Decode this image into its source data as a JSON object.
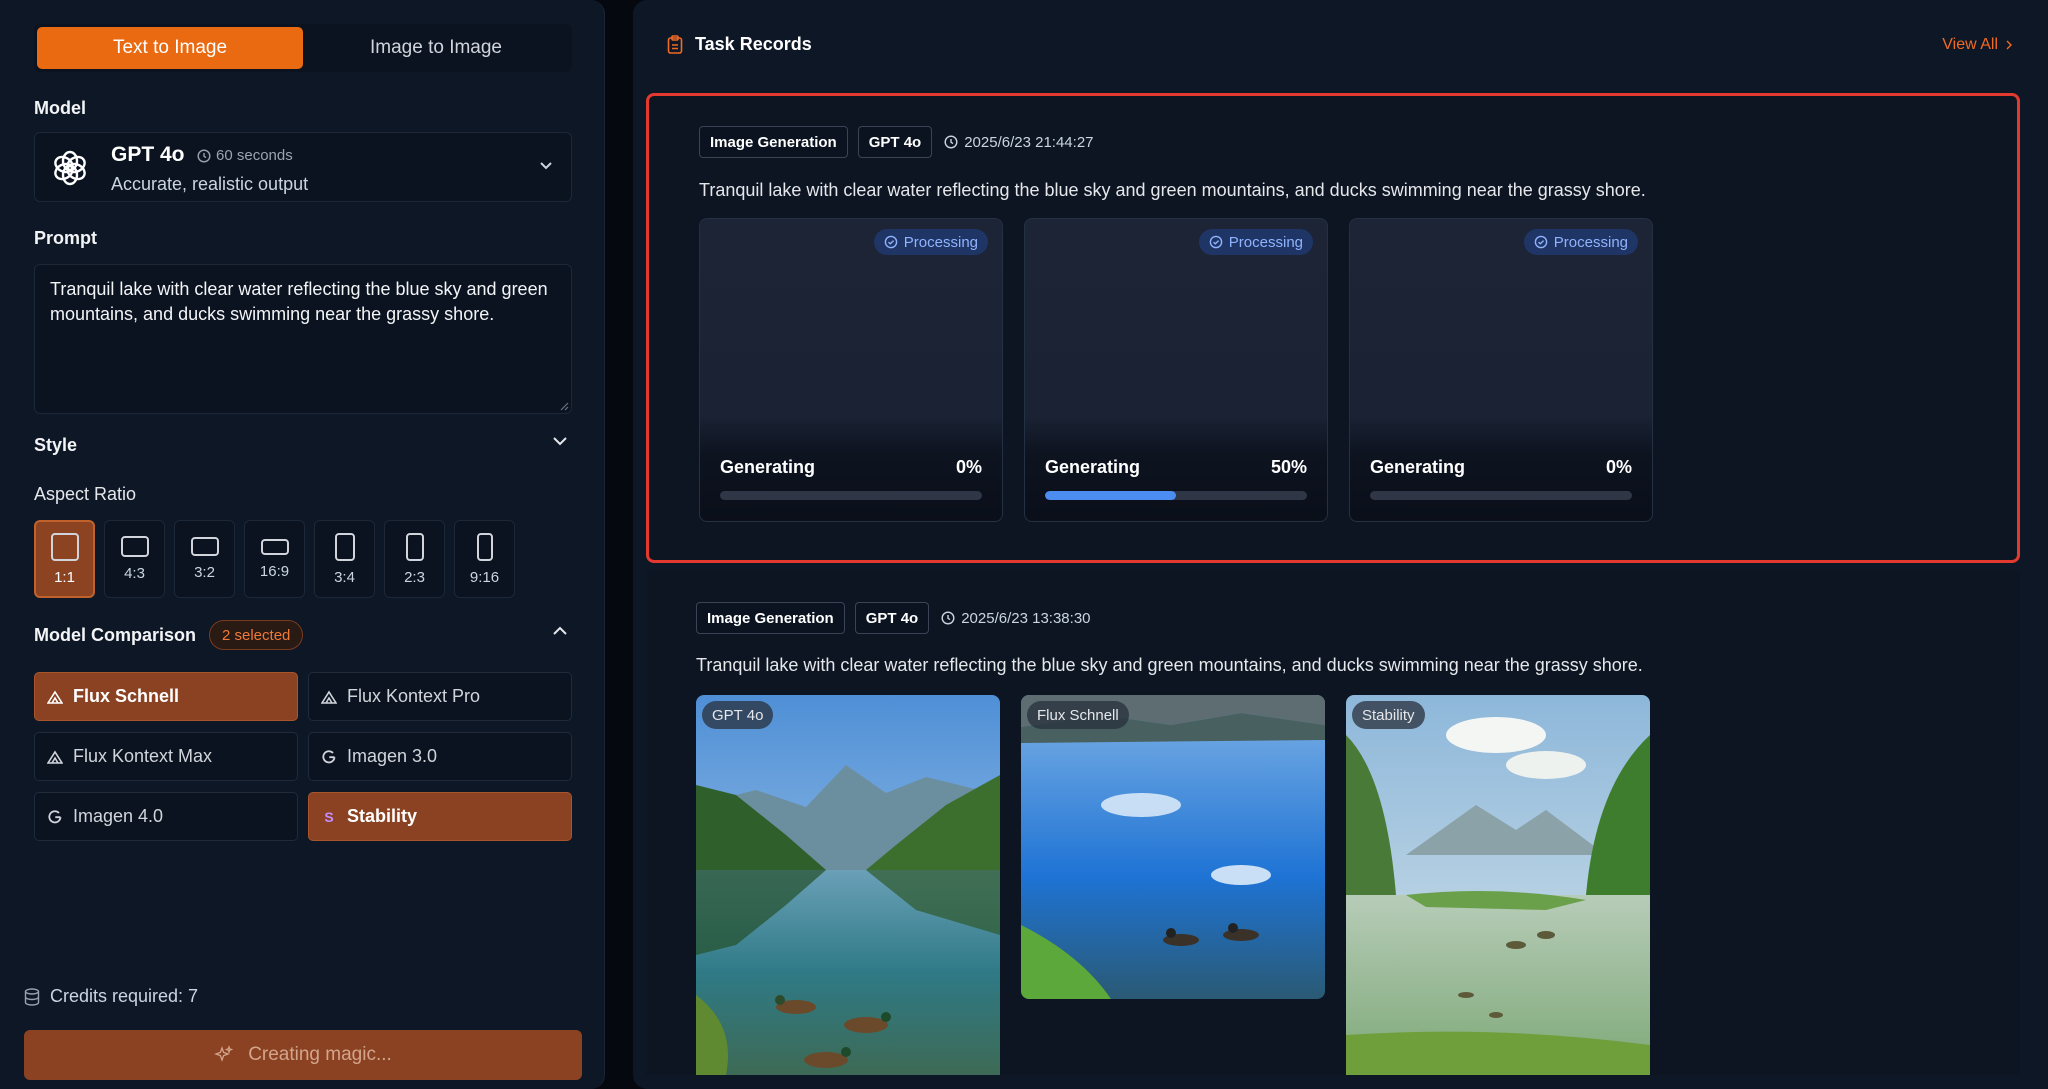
{
  "tabs": {
    "text_to_image": "Text to Image",
    "image_to_image": "Image to Image"
  },
  "model": {
    "label": "Model",
    "name": "GPT 4o",
    "time": "60 seconds",
    "desc": "Accurate, realistic output"
  },
  "prompt": {
    "label": "Prompt",
    "value": "Tranquil lake with clear water reflecting the blue sky and green mountains, and ducks swimming near the grassy shore."
  },
  "style": {
    "label": "Style"
  },
  "aspect": {
    "label": "Aspect Ratio",
    "items": [
      "1:1",
      "4:3",
      "3:2",
      "16:9",
      "3:4",
      "2:3",
      "9:16"
    ],
    "selected": "1:1"
  },
  "comparison": {
    "label": "Model Comparison",
    "badge": "2 selected",
    "models": [
      {
        "name": "Flux Schnell",
        "icon": "flux-icon",
        "selected": true
      },
      {
        "name": "Flux Kontext Pro",
        "icon": "flux-icon",
        "selected": false
      },
      {
        "name": "Flux Kontext Max",
        "icon": "flux-icon",
        "selected": false
      },
      {
        "name": "Imagen 3.0",
        "icon": "google-icon",
        "selected": false
      },
      {
        "name": "Imagen 4.0",
        "icon": "google-icon",
        "selected": false
      },
      {
        "name": "Stability",
        "icon": "stability-icon",
        "selected": true
      }
    ]
  },
  "credits": "Credits required: 7",
  "generate_label": "Creating magic...",
  "records": {
    "title": "Task Records",
    "view_all": "View All",
    "tasks": [
      {
        "type": "Image Generation",
        "model": "GPT 4o",
        "date": "2025/6/23 21:44:27",
        "prompt": "Tranquil lake with clear water reflecting the blue sky and green mountains, and ducks swimming near the grassy shore.",
        "jobs": [
          {
            "status": "Processing",
            "label": "Generating",
            "progress": "0%",
            "fraction": 0
          },
          {
            "status": "Processing",
            "label": "Generating",
            "progress": "50%",
            "fraction": 0.5
          },
          {
            "status": "Processing",
            "label": "Generating",
            "progress": "0%",
            "fraction": 0
          }
        ]
      },
      {
        "type": "Image Generation",
        "model": "GPT 4o",
        "date": "2025/6/23 13:38:30",
        "prompt": "Tranquil lake with clear water reflecting the blue sky and green mountains, and ducks swimming near the grassy shore.",
        "images": [
          {
            "label": "GPT 4o"
          },
          {
            "label": "Flux Schnell"
          },
          {
            "label": "Stability"
          }
        ]
      }
    ]
  }
}
